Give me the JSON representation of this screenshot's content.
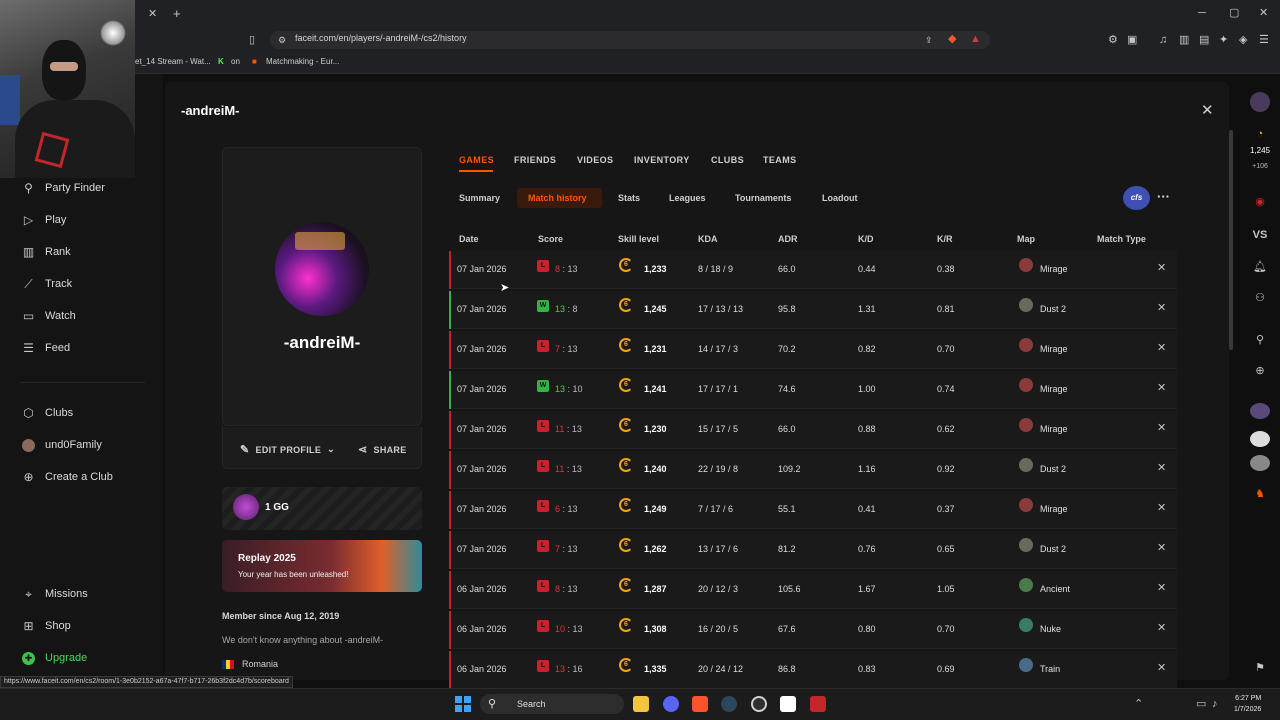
{
  "browser": {
    "url": "faceit.com/en/players/-andreiM-/cs2/history",
    "bookmarks": [
      "et_14 Stream - Wat...",
      "on",
      "Matchmaking - Eur..."
    ],
    "status_link": "https://www.faceit.com/en/cs2/room/1-3e0b2152-a67a-47f7-b717-26b3f2dc4d7b/scoreboard"
  },
  "leftnav": {
    "items": [
      {
        "label": "Party Finder",
        "icon": "party-finder-icon"
      },
      {
        "label": "Play",
        "icon": "play-icon"
      },
      {
        "label": "Rank",
        "icon": "rank-icon"
      },
      {
        "label": "Track",
        "icon": "track-icon"
      },
      {
        "label": "Watch",
        "icon": "watch-icon"
      },
      {
        "label": "Feed",
        "icon": "feed-icon"
      }
    ],
    "clubs": [
      {
        "label": "Clubs",
        "icon": "clubs-icon"
      },
      {
        "label": "und0Family",
        "icon": "club-avatar-icon"
      },
      {
        "label": "Create a Club",
        "icon": "plus-icon"
      }
    ],
    "bottom": [
      {
        "label": "Missions",
        "icon": "missions-icon"
      },
      {
        "label": "Shop",
        "icon": "shop-icon"
      },
      {
        "label": "Upgrade",
        "icon": "upgrade-icon"
      }
    ]
  },
  "profile": {
    "header_name": "-andreiM-",
    "card_name": "-andreiM-",
    "edit_label": "EDIT PROFILE",
    "share_label": "SHARE",
    "gg_label": "1 GG",
    "replay_title": "Replay 2025",
    "replay_sub": "Your year has been unleashed!",
    "member_since": "Member since Aug 12, 2019",
    "about": "We don't know anything about -andreiM-",
    "country": "Romania"
  },
  "tabs": [
    "GAMES",
    "FRIENDS",
    "VIDEOS",
    "INVENTORY",
    "CLUBS",
    "TEAMS"
  ],
  "subtabs": [
    "Summary",
    "Match history",
    "Stats",
    "Leagues",
    "Tournaments",
    "Loadout"
  ],
  "badge": "cfs",
  "table": {
    "headers": [
      "Date",
      "Score",
      "Skill level",
      "KDA",
      "ADR",
      "K/D",
      "K/R",
      "Map",
      "Match Type"
    ],
    "rows": [
      {
        "date": "07 Jan 2026",
        "result": "L",
        "own": "8",
        "opp": "13",
        "level": "6",
        "elo": "1,233",
        "kda": "8 / 18 / 9",
        "adr": "66.0",
        "kd": "0.44",
        "kr": "0.38",
        "map": "Mirage"
      },
      {
        "date": "07 Jan 2026",
        "result": "W",
        "own": "13",
        "opp": "8",
        "level": "6",
        "elo": "1,245",
        "kda": "17 / 13 / 13",
        "adr": "95.8",
        "kd": "1.31",
        "kr": "0.81",
        "map": "Dust 2"
      },
      {
        "date": "07 Jan 2026",
        "result": "L",
        "own": "7",
        "opp": "13",
        "level": "6",
        "elo": "1,231",
        "kda": "14 / 17 / 3",
        "adr": "70.2",
        "kd": "0.82",
        "kr": "0.70",
        "map": "Mirage"
      },
      {
        "date": "07 Jan 2026",
        "result": "W",
        "own": "13",
        "opp": "10",
        "level": "6",
        "elo": "1,241",
        "kda": "17 / 17 / 1",
        "adr": "74.6",
        "kd": "1.00",
        "kr": "0.74",
        "map": "Mirage"
      },
      {
        "date": "07 Jan 2026",
        "result": "L",
        "own": "11",
        "opp": "13",
        "level": "6",
        "elo": "1,230",
        "kda": "15 / 17 / 5",
        "adr": "66.0",
        "kd": "0.88",
        "kr": "0.62",
        "map": "Mirage"
      },
      {
        "date": "07 Jan 2026",
        "result": "L",
        "own": "11",
        "opp": "13",
        "level": "6",
        "elo": "1,240",
        "kda": "22 / 19 / 8",
        "adr": "109.2",
        "kd": "1.16",
        "kr": "0.92",
        "map": "Dust 2"
      },
      {
        "date": "07 Jan 2026",
        "result": "L",
        "own": "6",
        "opp": "13",
        "level": "6",
        "elo": "1,249",
        "kda": "7 / 17 / 6",
        "adr": "55.1",
        "kd": "0.41",
        "kr": "0.37",
        "map": "Mirage"
      },
      {
        "date": "07 Jan 2026",
        "result": "L",
        "own": "7",
        "opp": "13",
        "level": "6",
        "elo": "1,262",
        "kda": "13 / 17 / 6",
        "adr": "81.2",
        "kd": "0.76",
        "kr": "0.65",
        "map": "Dust 2"
      },
      {
        "date": "06 Jan 2026",
        "result": "L",
        "own": "8",
        "opp": "13",
        "level": "6",
        "elo": "1,287",
        "kda": "20 / 12 / 3",
        "adr": "105.6",
        "kd": "1.67",
        "kr": "1.05",
        "map": "Ancient"
      },
      {
        "date": "06 Jan 2026",
        "result": "L",
        "own": "10",
        "opp": "13",
        "level": "6",
        "elo": "1,308",
        "kda": "16 / 20 / 5",
        "adr": "67.6",
        "kd": "0.80",
        "kr": "0.70",
        "map": "Nuke"
      },
      {
        "date": "06 Jan 2026",
        "result": "L",
        "own": "13",
        "opp": "16",
        "level": "6",
        "elo": "1,335",
        "kda": "20 / 24 / 12",
        "adr": "86.8",
        "kd": "0.83",
        "kr": "0.69",
        "map": "Train"
      }
    ]
  },
  "rightbar": {
    "elo": "1,245",
    "delta": "+106",
    "vs": "VS"
  },
  "taskbar": {
    "search": "Search",
    "time": "6:27 PM",
    "date": "1/7/2026"
  },
  "colors": {
    "accent": "#ff5500",
    "win": "#32b442",
    "loss": "#c7232f"
  }
}
